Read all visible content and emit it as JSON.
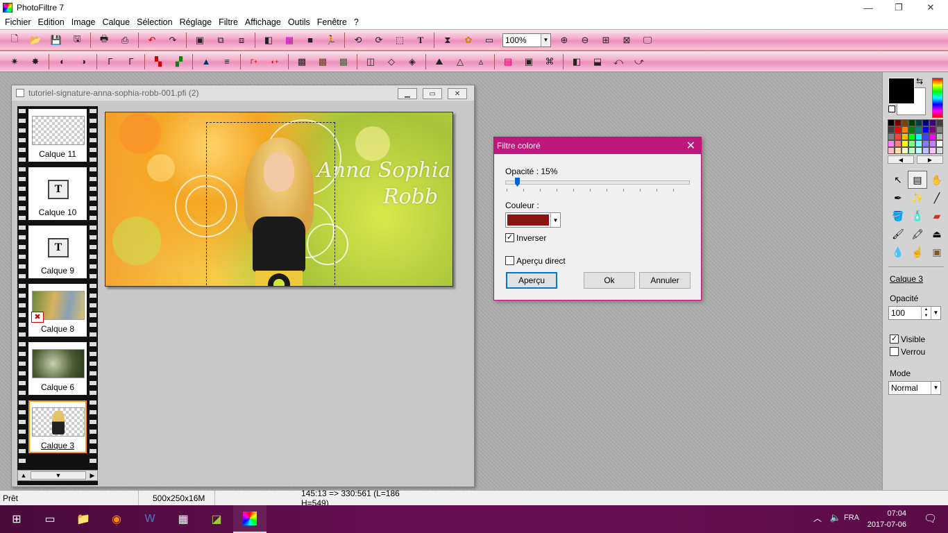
{
  "app": {
    "title": "PhotoFiltre 7"
  },
  "menu": [
    "Fichier",
    "Edition",
    "Image",
    "Calque",
    "Sélection",
    "Réglage",
    "Filtre",
    "Affichage",
    "Outils",
    "Fenêtre",
    "?"
  ],
  "toolbar": {
    "zoom_value": "100%",
    "icons_row1": [
      "new-icon",
      "open-icon",
      "save-icon",
      "save-as-icon",
      "print-icon",
      "scan-icon",
      "undo-icon",
      "redo-icon",
      "paste-icon",
      "copy-icon",
      "cut-icon",
      "gradient-icon",
      "color-grid-icon",
      "dark-color-icon",
      "transform-icon",
      "rotate-icon",
      "crop-icon",
      "select-icon",
      "text-icon",
      "layers-icon",
      "effects-icon",
      "window-icon",
      "zoom-in-icon",
      "zoom-out-icon",
      "fit-icon",
      "fullscreen-icon",
      "monitor-icon"
    ],
    "icons_row2": [
      "contrast-plus-icon",
      "brightness-plus-icon",
      "saturation-icon",
      "saturation-plus-icon",
      "gamma-icon",
      "gamma-plus-icon",
      "color-balance-icon",
      "color-plus-icon",
      "levels-icon",
      "curves-icon",
      "auto-levels-icon",
      "auto-contrast-icon",
      "grayscale-icon",
      "sepia-icon",
      "grain-icon",
      "blur-icon",
      "sharpen-icon",
      "soften-icon",
      "emboss-icon",
      "sharpen-more-icon",
      "blur-more-icon",
      "rainbow-icon",
      "frame-icon",
      "puzzle-icon",
      "flip-h-icon",
      "flip-v-icon",
      "rotate-left-icon",
      "rotate-right-icon"
    ]
  },
  "document": {
    "title": "tutoriel-signature-anna-sophia-robb-001.pfi (2)",
    "signature_line1": "Anna Sophia",
    "signature_line2": "Robb",
    "layers": [
      {
        "name": "Calque 11",
        "type": "checker"
      },
      {
        "name": "Calque 10",
        "type": "text"
      },
      {
        "name": "Calque 9",
        "type": "text"
      },
      {
        "name": "Calque 8",
        "type": "image"
      },
      {
        "name": "Calque 6",
        "type": "image"
      },
      {
        "name": "Calque 3",
        "type": "person",
        "selected": true
      }
    ]
  },
  "dialog": {
    "title": "Filtre coloré",
    "opacity_label": "Opacité : 15%",
    "opacity_value": 15,
    "color_label": "Couleur :",
    "color_value": "#8b1414",
    "invert_label": "Inverser",
    "invert_checked": true,
    "preview_label": "Aperçu direct",
    "preview_checked": false,
    "btn_preview": "Aperçu",
    "btn_ok": "Ok",
    "btn_cancel": "Annuler"
  },
  "right_panel": {
    "layer_name": "Calque 3",
    "opacity_label": "Opacité",
    "opacity_value": "100",
    "visible_label": "Visible",
    "visible_checked": true,
    "lock_label": "Verrou",
    "lock_checked": false,
    "mode_label": "Mode",
    "mode_value": "Normal",
    "tools": [
      "pointer-icon",
      "layer-select-icon",
      "hand-icon",
      "eyedropper-icon",
      "magic-wand-icon",
      "line-icon",
      "fill-bucket-icon",
      "spray-icon",
      "eraser-icon",
      "brush-icon",
      "advanced-brush-icon",
      "stamp-icon",
      "blur-drop-icon",
      "smudge-icon",
      "clone-icon"
    ],
    "palette": [
      "#000",
      "#800000",
      "#804000",
      "#004000",
      "#004040",
      "#000080",
      "#400080",
      "#404040",
      "#404040",
      "#ff0000",
      "#ff8000",
      "#008000",
      "#008080",
      "#0000ff",
      "#800080",
      "#808080",
      "#808080",
      "#ff4040",
      "#ffc000",
      "#00ff00",
      "#00ffff",
      "#4040ff",
      "#ff00ff",
      "#c0c0c0",
      "#ff80ff",
      "#ff8080",
      "#ffff00",
      "#80ff80",
      "#80ffff",
      "#8080ff",
      "#c080ff",
      "#ffffff",
      "#ffc0c0",
      "#ffe0a0",
      "#ffffc0",
      "#c0ffc0",
      "#c0ffff",
      "#c0c0ff",
      "#ffc0ff",
      "#e0e0e0"
    ]
  },
  "status": {
    "state": "Prêt",
    "size": "500x250x16M",
    "coords": "145:13 => 330:561 (L=186  H=549)"
  },
  "taskbar": {
    "lang": "FRA",
    "time": "07:04",
    "date": "2017-07-06"
  },
  "colors": {
    "accent": "#c0187a",
    "toolbar_pink": "#ee8fbb",
    "taskbar": "#5a0c46"
  }
}
